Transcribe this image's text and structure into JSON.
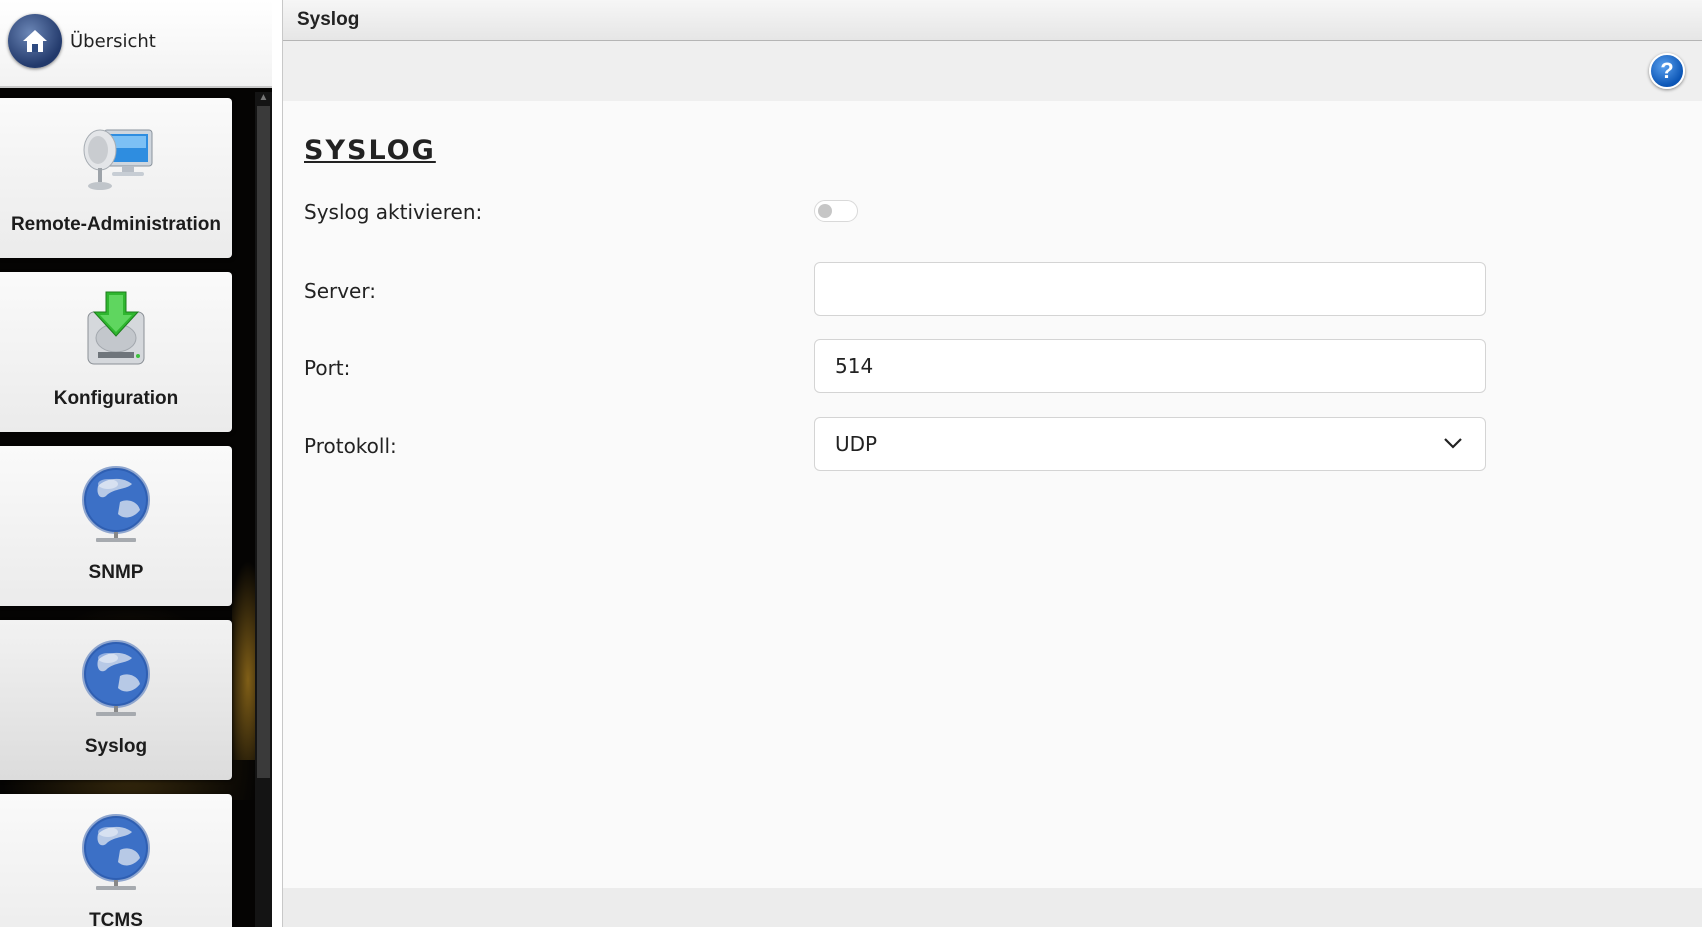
{
  "sidebar": {
    "home_label": "Übersicht",
    "items": [
      {
        "label": "Remote-Administration",
        "icon": "remote-admin-icon"
      },
      {
        "label": "Konfiguration",
        "icon": "download-disk-icon"
      },
      {
        "label": "SNMP",
        "icon": "globe-network-icon"
      },
      {
        "label": "Syslog",
        "icon": "globe-network-icon",
        "active": true
      },
      {
        "label": "TCMS",
        "icon": "globe-network-icon"
      }
    ]
  },
  "header": {
    "title": "Syslog",
    "help_icon": "help-icon"
  },
  "form": {
    "section_title": "SYSLOG",
    "enable_label": "Syslog aktivieren:",
    "enable_value": false,
    "server_label": "Server:",
    "server_value": "",
    "port_label": "Port:",
    "port_value": "514",
    "protocol_label": "Protokoll:",
    "protocol_value": "UDP"
  },
  "colors": {
    "accent": "#1a5fbf",
    "sidebar_bg": "#050403"
  }
}
